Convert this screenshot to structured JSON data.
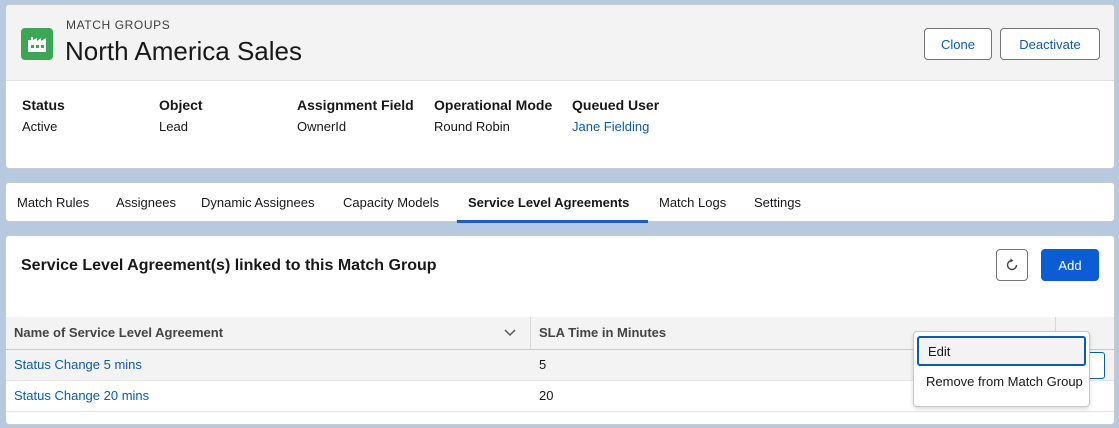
{
  "header": {
    "object_label": "MATCH GROUPS",
    "title": "North America Sales",
    "icon": "factory-icon",
    "icon_color": "#3ba755",
    "buttons": {
      "clone": "Clone",
      "deactivate": "Deactivate"
    }
  },
  "fields": [
    {
      "label": "Status",
      "value": "Active",
      "link": false
    },
    {
      "label": "Object",
      "value": "Lead",
      "link": false
    },
    {
      "label": "Assignment Field",
      "value": "OwnerId",
      "link": false
    },
    {
      "label": "Operational Mode",
      "value": "Round Robin",
      "link": false
    },
    {
      "label": "Queued User",
      "value": "Jane Fielding",
      "link": true
    }
  ],
  "tabs": [
    {
      "label": "Match Rules",
      "active": false
    },
    {
      "label": "Assignees",
      "active": false
    },
    {
      "label": "Dynamic Assignees",
      "active": false
    },
    {
      "label": "Capacity Models",
      "active": false
    },
    {
      "label": "Service Level Agreements",
      "active": true
    },
    {
      "label": "Match Logs",
      "active": false
    },
    {
      "label": "Settings",
      "active": false
    }
  ],
  "main": {
    "title": "Service Level Agreement(s) linked to this Match Group",
    "refresh_icon": "refresh-icon",
    "add_label": "Add",
    "accent_color": "#0b5cd5",
    "table": {
      "columns": [
        "Name of Service Level Agreement",
        "SLA Time in Minutes"
      ],
      "rows": [
        {
          "name": "Status Change 5 mins",
          "minutes": "5"
        },
        {
          "name": "Status Change 20 mins",
          "minutes": "20"
        }
      ]
    }
  },
  "row_menu": {
    "items": [
      "Edit",
      "Remove from Match Group"
    ]
  }
}
